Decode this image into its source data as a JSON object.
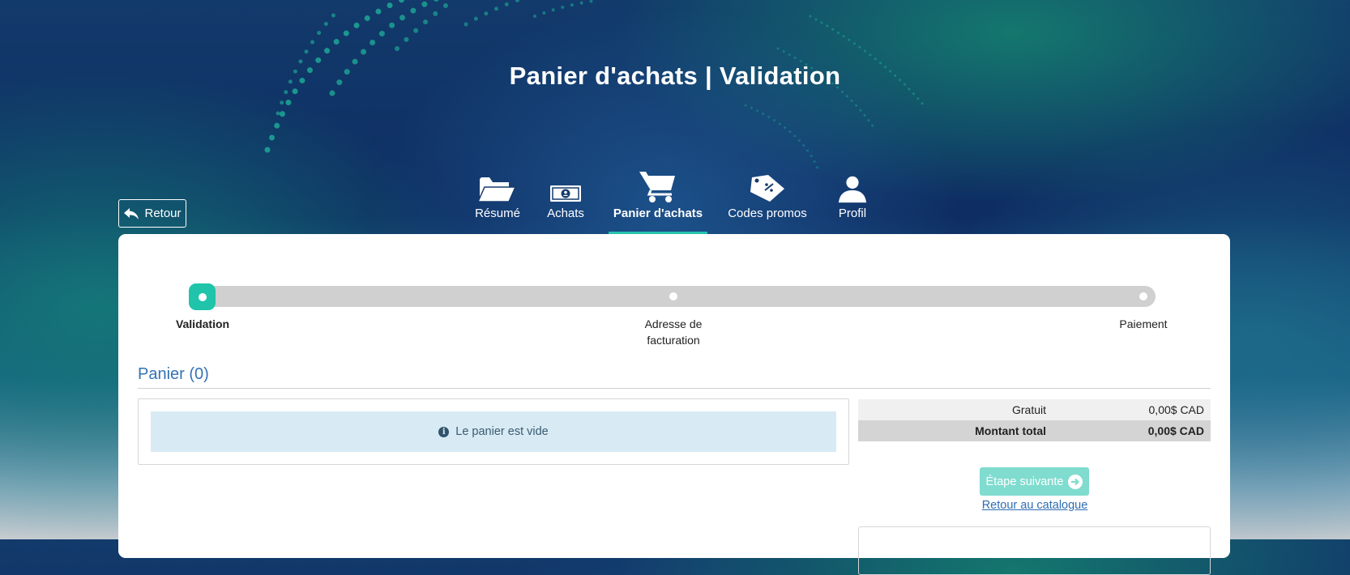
{
  "page_title": "Panier d'achats | Validation",
  "back_button": {
    "label": "Retour"
  },
  "nav": {
    "items": [
      {
        "label": "Résumé",
        "icon": "folder-icon"
      },
      {
        "label": "Achats",
        "icon": "money-icon"
      },
      {
        "label": "Panier d'achats",
        "icon": "cart-icon",
        "active": true
      },
      {
        "label": "Codes promos",
        "icon": "tag-icon"
      },
      {
        "label": "Profil",
        "icon": "user-icon"
      }
    ]
  },
  "steps": [
    {
      "label": "Validation",
      "active": true
    },
    {
      "label_line1": "Adresse de",
      "label_line2": "facturation",
      "active": false
    },
    {
      "label": "Paiement",
      "active": false
    }
  ],
  "cart": {
    "title": "Panier (0)",
    "empty_message": "Le panier est vide"
  },
  "summary": {
    "rows": [
      {
        "label": "Gratuit",
        "value": "0,00$ CAD"
      },
      {
        "label": "Montant total",
        "value": "0,00$ CAD"
      }
    ]
  },
  "actions": {
    "next_label": "Étape suivante",
    "catalog_link": "Retour au catalogue"
  },
  "colors": {
    "accent": "#1fc4aa",
    "link": "#2f6db3",
    "alert_bg": "#d8ebf4"
  }
}
